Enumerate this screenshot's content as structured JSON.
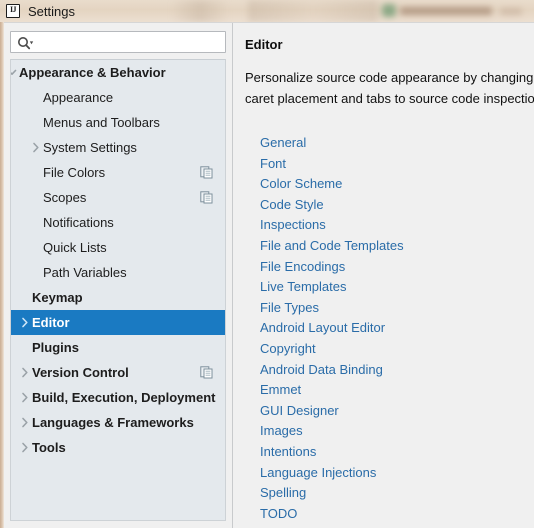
{
  "window": {
    "title": "Settings",
    "logo_text": "IJ",
    "logo_icon": "intellij-idea-logo-icon"
  },
  "search": {
    "value": "",
    "placeholder": "",
    "icon": "search-icon"
  },
  "sidebar": {
    "items": [
      {
        "label": "Appearance & Behavior",
        "indent": 8,
        "bold": true,
        "twisty": "chevron-down",
        "badge": false,
        "selected": false
      },
      {
        "label": "Appearance",
        "indent": 32,
        "bold": false,
        "twisty": "none",
        "badge": false,
        "selected": false
      },
      {
        "label": "Menus and Toolbars",
        "indent": 32,
        "bold": false,
        "twisty": "none",
        "badge": false,
        "selected": false
      },
      {
        "label": "System Settings",
        "indent": 32,
        "bold": false,
        "twisty": "chevron-right",
        "badge": false,
        "selected": false
      },
      {
        "label": "File Colors",
        "indent": 32,
        "bold": false,
        "twisty": "none",
        "badge": true,
        "selected": false
      },
      {
        "label": "Scopes",
        "indent": 32,
        "bold": false,
        "twisty": "none",
        "badge": true,
        "selected": false
      },
      {
        "label": "Notifications",
        "indent": 32,
        "bold": false,
        "twisty": "none",
        "badge": false,
        "selected": false
      },
      {
        "label": "Quick Lists",
        "indent": 32,
        "bold": false,
        "twisty": "none",
        "badge": false,
        "selected": false
      },
      {
        "label": "Path Variables",
        "indent": 32,
        "bold": false,
        "twisty": "none",
        "badge": false,
        "selected": false
      },
      {
        "label": "Keymap",
        "indent": 21,
        "bold": true,
        "twisty": "none",
        "badge": false,
        "selected": false
      },
      {
        "label": "Editor",
        "indent": 21,
        "bold": true,
        "twisty": "chevron-right",
        "badge": false,
        "selected": true
      },
      {
        "label": "Plugins",
        "indent": 21,
        "bold": true,
        "twisty": "none",
        "badge": false,
        "selected": false
      },
      {
        "label": "Version Control",
        "indent": 21,
        "bold": true,
        "twisty": "chevron-right",
        "badge": true,
        "selected": false
      },
      {
        "label": "Build, Execution, Deployment",
        "indent": 21,
        "bold": true,
        "twisty": "chevron-right",
        "badge": false,
        "selected": false
      },
      {
        "label": "Languages & Frameworks",
        "indent": 21,
        "bold": true,
        "twisty": "chevron-right",
        "badge": false,
        "selected": false
      },
      {
        "label": "Tools",
        "indent": 21,
        "bold": true,
        "twisty": "chevron-right",
        "badge": false,
        "selected": false
      }
    ]
  },
  "detail": {
    "title": "Editor",
    "description": "Personalize source code appearance by changing\ncaret placement and tabs to source code inspectio",
    "links": [
      "General",
      "Font",
      "Color Scheme",
      "Code Style",
      "Inspections",
      "File and Code Templates",
      "File Encodings",
      "Live Templates",
      "File Types",
      "Android Layout Editor",
      "Copyright",
      "Android Data Binding",
      "Emmet",
      "GUI Designer",
      "Images",
      "Intentions",
      "Language Injections",
      "Spelling",
      "TODO"
    ]
  },
  "colors": {
    "selection_blue": "#1a7ac2",
    "link_blue": "#2a6ca8",
    "tree_background": "#e4e9ed",
    "panel_background": "#f0f0f0",
    "titlebar_tan": "#e6d6c4"
  }
}
